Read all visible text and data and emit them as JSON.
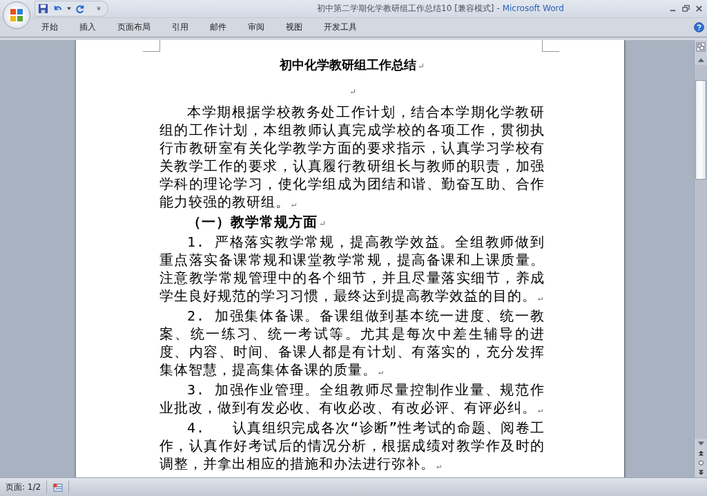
{
  "window": {
    "title": "初中第二学期化学教研组工作总结10 [兼容模式]",
    "app_name": "- Microsoft Word"
  },
  "tabs": [
    {
      "label": "开始",
      "selected": false
    },
    {
      "label": "插入",
      "selected": false
    },
    {
      "label": "页面布局",
      "selected": false
    },
    {
      "label": "引用",
      "selected": false
    },
    {
      "label": "邮件",
      "selected": false
    },
    {
      "label": "审阅",
      "selected": false
    },
    {
      "label": "视图",
      "selected": false
    },
    {
      "label": "开发工具",
      "selected": false
    }
  ],
  "document": {
    "paragraphs": [
      {
        "kind": "title",
        "text": "初中化学教研组工作总结",
        "mark": "↵"
      },
      {
        "kind": "empty",
        "mark": "↵"
      },
      {
        "kind": "body",
        "text": "本学期根据学校教务处工作计划，结合本学期化学教研组的工作计划，本组教师认真完成学校的各项工作，贯彻执行市教研室有关化学教学方面的要求指示，认真学习学校有关教学工作的要求，认真履行教研组长与教师的职责，加强学科的理论学习，使化学组成为团结和谐、勤奋互助、合作能力较强的教研组。",
        "mark": "↵"
      },
      {
        "kind": "heading",
        "text": "（一）教学常规方面",
        "mark": "↵"
      },
      {
        "kind": "body",
        "text": "1. 严格落实教学常规，提高教学效益。全组教师做到重点落实备课常规和课堂教学常规，提高备课和上课质量。注意教学常规管理中的各个细节，并且尽量落实细节，养成学生良好规范的学习习惯，最终达到提高教学效益的目的。",
        "mark": "↵"
      },
      {
        "kind": "body",
        "text": "2. 加强集体备课。备课组做到基本统一进度、统一教案、统一练习、统一考试等。尤其是每次中差生辅导的进度、内容、时间、备课人都是有计划、有落实的，充分发挥集体智慧，提高集体备课的质量。",
        "mark": "↵"
      },
      {
        "kind": "body",
        "text": "3. 加强作业管理。全组教师尽量控制作业量、规范作业批改，做到有发必收、有收必改、有改必评、有评必纠。",
        "mark": "↵"
      },
      {
        "kind": "body",
        "text": "4.   认真组织完成各次“诊断”性考试的命题、阅卷工作，认真作好考试后的情况分析，根据成绩对教学作及时的调整，并拿出相应的措施和办法进行弥补。",
        "mark": "↵"
      }
    ]
  },
  "status_bar": {
    "page": "页面: 1/2"
  }
}
